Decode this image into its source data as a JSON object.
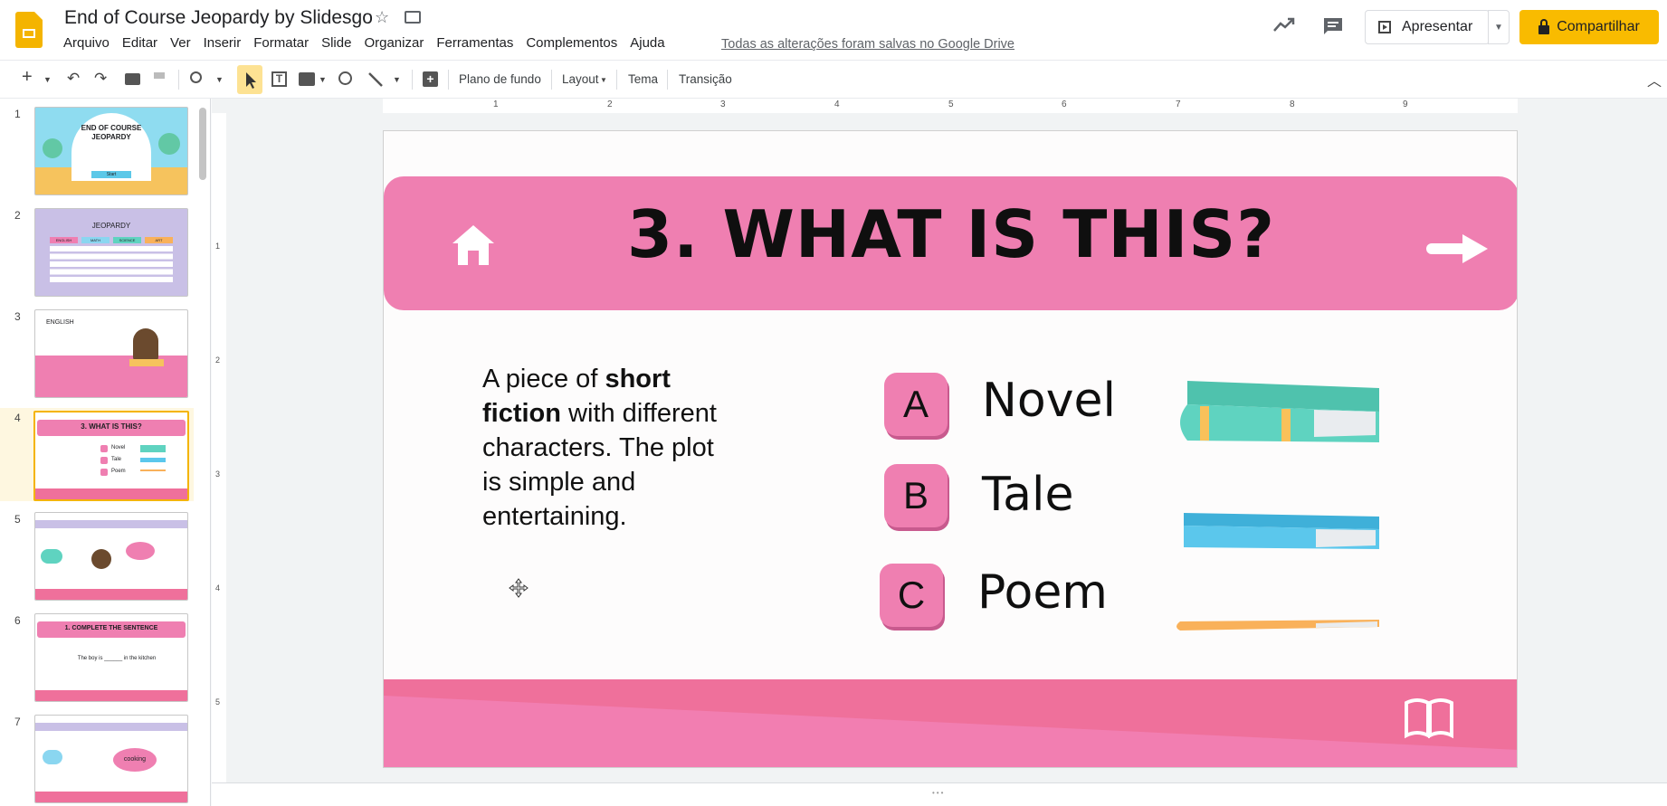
{
  "header": {
    "doc_title": "End of Course Jeopardy by Slidesgo",
    "menu": [
      "Arquivo",
      "Editar",
      "Ver",
      "Inserir",
      "Formatar",
      "Slide",
      "Organizar",
      "Ferramentas",
      "Complementos",
      "Ajuda"
    ],
    "save_status": "Todas as alterações foram salvas no Google Drive",
    "present_label": "Apresentar",
    "share_label": "Compartilhar",
    "accent": "#f9bb00"
  },
  "toolbar": {
    "background_label": "Plano de fundo",
    "layout_label": "Layout",
    "theme_label": "Tema",
    "transition_label": "Transição"
  },
  "ruler": {
    "h_ticks": [
      "1",
      "2",
      "3",
      "4",
      "5",
      "6",
      "7",
      "8",
      "9"
    ],
    "v_ticks": [
      "1",
      "2",
      "3",
      "4",
      "5"
    ]
  },
  "filmstrip": {
    "slides": [
      {
        "num": "1",
        "text": "END OF COURSE JEOPARDY",
        "sub": "Start"
      },
      {
        "num": "2",
        "text": "JEOPARDY",
        "sub": ""
      },
      {
        "num": "3",
        "text": "ENGLISH",
        "sub": ""
      },
      {
        "num": "4",
        "text": "3. WHAT IS THIS?",
        "sub": ""
      },
      {
        "num": "5",
        "text": "",
        "sub": ""
      },
      {
        "num": "6",
        "text": "1. COMPLETE THE SENTENCE",
        "sub": "The boy is ______ in the kitchen"
      },
      {
        "num": "7",
        "text": "",
        "sub": "cooking"
      }
    ],
    "thumb4_options": [
      "Novel",
      "Tale",
      "Poem"
    ],
    "jeopardy_categories": [
      "ENGLISH",
      "MATH",
      "SCIENCE",
      "ART"
    ]
  },
  "slide": {
    "title": "3. WHAT IS THIS?",
    "question_parts": {
      "p1": "A piece of ",
      "b1": "short",
      "b2": "fiction",
      "p2": " with different characters. The plot is simple and entertaining."
    },
    "options": [
      {
        "letter": "A",
        "label": "Novel"
      },
      {
        "letter": "B",
        "label": "Tale"
      },
      {
        "letter": "C",
        "label": "Poem"
      }
    ],
    "colors": {
      "pink": "#ef7fb1",
      "footer": "#ef709b",
      "teal_book": "#5fd3c0",
      "blue_book": "#5bc7ec",
      "orange_book": "#f9b15a"
    }
  }
}
